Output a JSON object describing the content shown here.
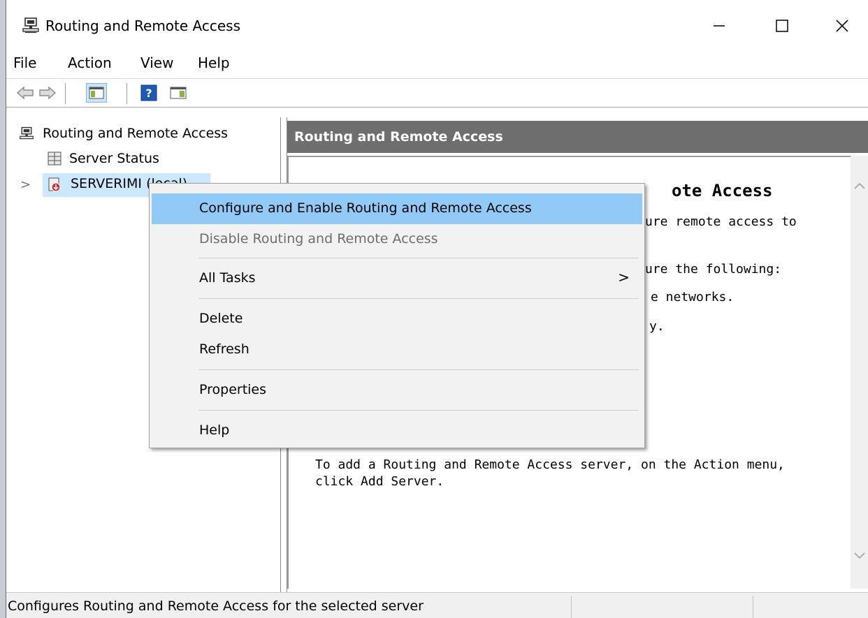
{
  "window": {
    "title": "Routing and Remote Access"
  },
  "menubar": {
    "items": [
      "File",
      "Action",
      "View",
      "Help"
    ]
  },
  "tree": {
    "root": "Routing and Remote Access",
    "children": [
      "Server Status",
      "SERVERIMI (local)"
    ],
    "expander": ">"
  },
  "right_pane": {
    "header": "Routing and Remote Access",
    "welcome_title": "Welcome to Routing and Remote Access",
    "visible_fragments": {
      "title_tail": "ote Access",
      "line1_tail": "ure remote access to",
      "line2_tail": "ure the following:",
      "line3_tail": "e networks.",
      "line4_tail": "y."
    },
    "add_server_line1": "To add a Routing and Remote Access server, on the Action menu,",
    "add_server_line2": "click Add Server."
  },
  "context_menu": {
    "items": [
      {
        "label": "Configure and Enable Routing and Remote Access",
        "state": "highlighted"
      },
      {
        "label": "Disable Routing and Remote Access",
        "state": "disabled"
      },
      {
        "label": "All Tasks",
        "submenu": true,
        "arrow": ">"
      },
      {
        "label": "Delete"
      },
      {
        "label": "Refresh"
      },
      {
        "label": "Properties"
      },
      {
        "label": "Help"
      }
    ]
  },
  "statusbar": {
    "text": "Configures Routing and Remote Access for the selected server"
  },
  "colors": {
    "highlight": "#91c9f7",
    "tree_selection": "#cce8ff",
    "header_bg": "#6e6e6e"
  },
  "icons": {
    "app": "server-computer-icon",
    "back": "back-arrow-icon",
    "forward": "forward-arrow-icon",
    "show_hide_tree": "console-tree-icon",
    "help": "help-icon",
    "show_hide_action": "action-pane-icon",
    "server_status": "server-status-icon",
    "server": "server-disabled-icon"
  }
}
